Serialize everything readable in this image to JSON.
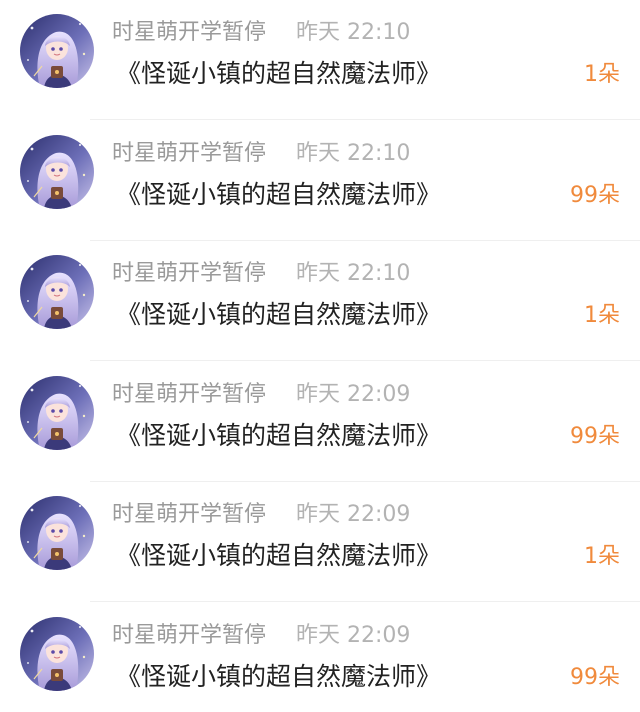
{
  "comments": [
    {
      "username": "时星萌开学暂停",
      "time": "昨天 22:10",
      "message": "《怪诞小镇的超自然魔法师》",
      "gift": "1朵"
    },
    {
      "username": "时星萌开学暂停",
      "time": "昨天 22:10",
      "message": "《怪诞小镇的超自然魔法师》",
      "gift": "99朵"
    },
    {
      "username": "时星萌开学暂停",
      "time": "昨天 22:10",
      "message": "《怪诞小镇的超自然魔法师》",
      "gift": "1朵"
    },
    {
      "username": "时星萌开学暂停",
      "time": "昨天 22:09",
      "message": "《怪诞小镇的超自然魔法师》",
      "gift": "99朵"
    },
    {
      "username": "时星萌开学暂停",
      "time": "昨天 22:09",
      "message": "《怪诞小镇的超自然魔法师》",
      "gift": "1朵"
    },
    {
      "username": "时星萌开学暂停",
      "time": "昨天 22:09",
      "message": "《怪诞小镇的超自然魔法师》",
      "gift": "99朵"
    }
  ],
  "colors": {
    "gift": "#f08a3c",
    "username": "#9a9a9a",
    "time": "#b3b3b3",
    "message": "#222222"
  },
  "icons": {
    "avatar": "anime-girl-avatar"
  }
}
